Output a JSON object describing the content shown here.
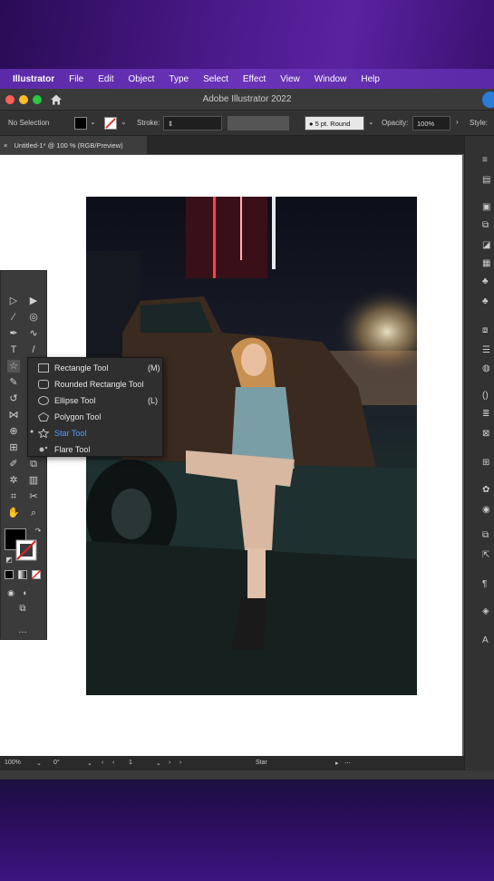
{
  "menubar": {
    "app": "Illustrator",
    "items": [
      "File",
      "Edit",
      "Object",
      "Type",
      "Select",
      "Effect",
      "View",
      "Window",
      "Help"
    ]
  },
  "titlebar": {
    "title": "Adobe Illustrator 2022"
  },
  "controlbar": {
    "selection": "No Selection",
    "stroke_label": "Stroke:",
    "brush": "5 pt. Round",
    "opacity_label": "Opacity:",
    "opacity_value": "100%",
    "style_label": "Style:"
  },
  "document_tab": {
    "label": "Untitled-1* @ 100 % (RGB/Preview)",
    "close": "×"
  },
  "flyout": {
    "items": [
      {
        "label": "Rectangle Tool",
        "shortcut": "(M)",
        "icon": "rectangle-icon"
      },
      {
        "label": "Rounded Rectangle Tool",
        "shortcut": "",
        "icon": "rounded-rectangle-icon"
      },
      {
        "label": "Ellipse Tool",
        "shortcut": "(L)",
        "icon": "ellipse-icon"
      },
      {
        "label": "Polygon Tool",
        "shortcut": "",
        "icon": "polygon-icon"
      },
      {
        "label": "Star Tool",
        "shortcut": "",
        "icon": "star-icon",
        "selected": true
      },
      {
        "label": "Flare Tool",
        "shortcut": "",
        "icon": "flare-icon"
      }
    ]
  },
  "statusbar": {
    "zoom": "100%",
    "rotation": "0°",
    "artboard": "1",
    "current_tool": "Star"
  },
  "colors": {
    "menubar": "#6a33b8",
    "selected_text": "#4aa3ff",
    "fill_swatch": "#000000"
  }
}
